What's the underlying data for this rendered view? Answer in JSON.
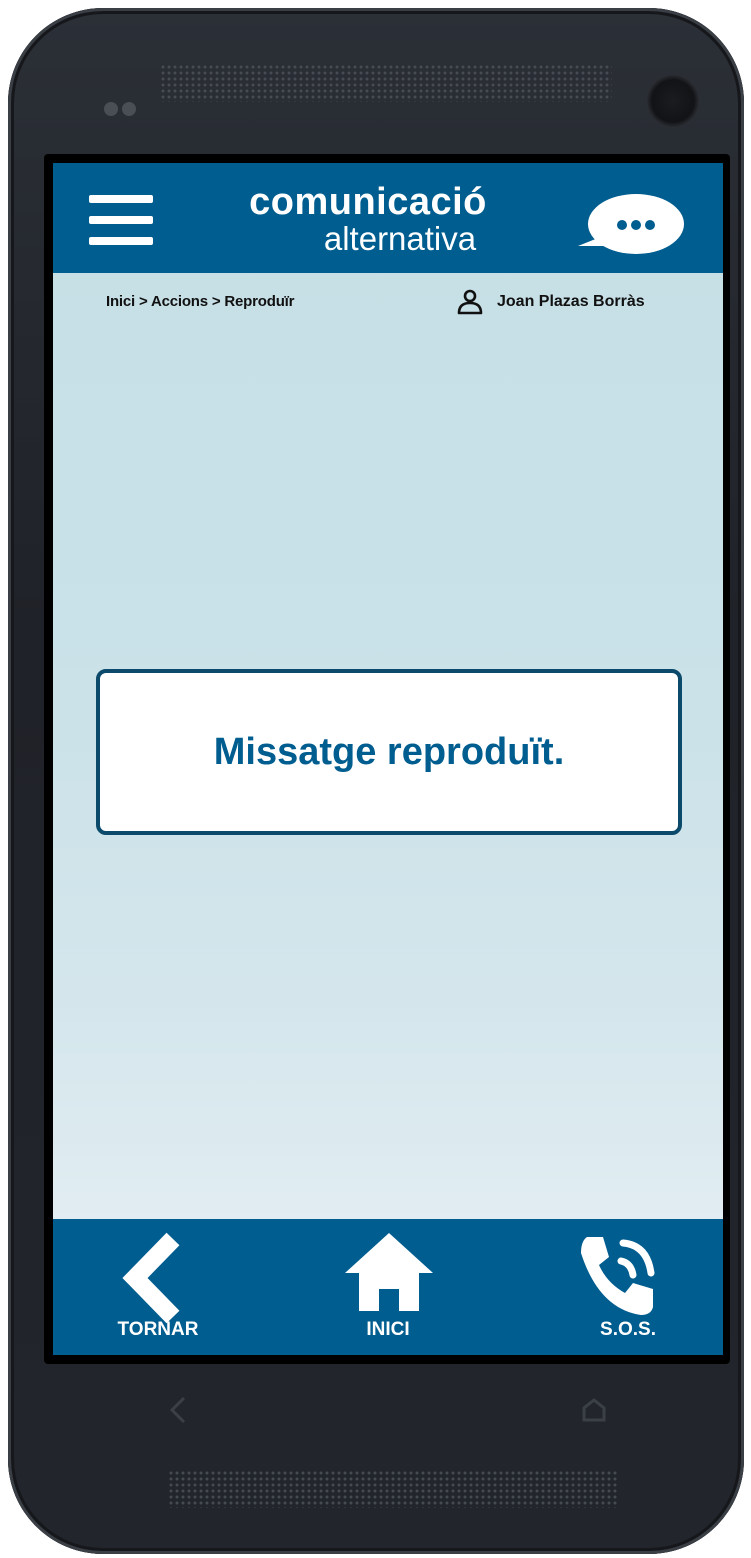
{
  "header": {
    "menu_icon": "hamburger-menu-icon",
    "logo_line1": "comunicació",
    "logo_line2": "alternativa",
    "chat_icon": "chat-bubble-icon"
  },
  "breadcrumb": "Inici > Accions > Reproduïr",
  "user": {
    "icon": "user-icon",
    "name": "Joan Plazas Borràs"
  },
  "message": "Missatge reproduït.",
  "bottom_nav": [
    {
      "label": "TORNAR",
      "icon": "chevron-left-icon"
    },
    {
      "label": "INICI",
      "icon": "home-icon"
    },
    {
      "label": "S.O.S.",
      "icon": "phone-call-icon"
    }
  ],
  "colors": {
    "brand": "#005d8f",
    "message_border": "#0b4a6a",
    "background_top": "#c6dfe6"
  }
}
